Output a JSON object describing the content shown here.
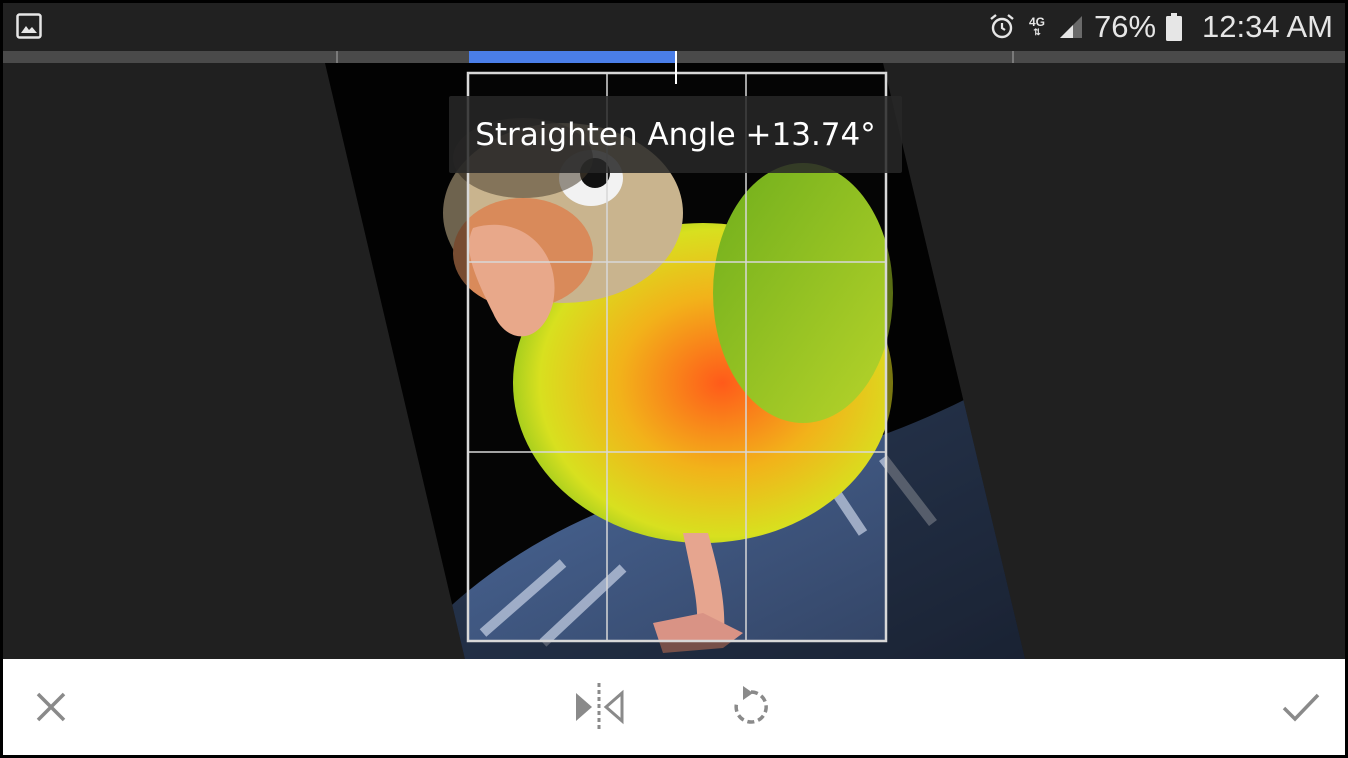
{
  "status_bar": {
    "left_icon": "gallery-icon",
    "alarm_icon": "alarm-icon",
    "network_label": "4G",
    "signal_icon": "signal-icon",
    "battery_percent": "76%",
    "battery_icon": "battery-icon",
    "time": "12:34 AM"
  },
  "straighten": {
    "label": "Straighten Angle +13.74°",
    "angle_degrees": 13.74
  },
  "toolbar": {
    "cancel_icon": "close-icon",
    "flip_icon": "flip-horizontal-icon",
    "rotate_icon": "rotate-icon",
    "apply_icon": "check-icon"
  },
  "colors": {
    "accent": "#4a7ee8",
    "background": "#212121",
    "toolbar_bg": "#ffffff",
    "icon_gray": "#8a8a8a"
  }
}
